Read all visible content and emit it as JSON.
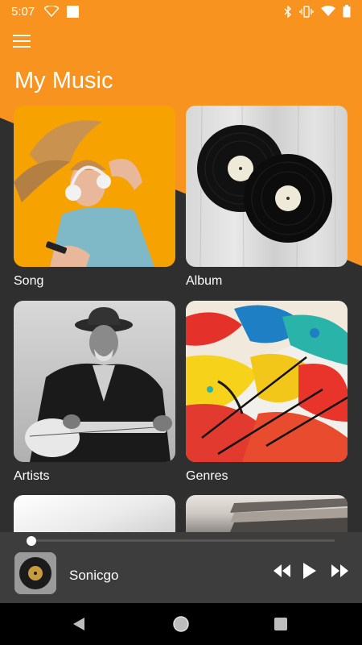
{
  "status_bar": {
    "time": "5:07"
  },
  "header": {
    "title": "My Music"
  },
  "tiles": [
    {
      "label": "Song"
    },
    {
      "label": "Album"
    },
    {
      "label": "Artists"
    },
    {
      "label": "Genres"
    },
    {
      "label": ""
    },
    {
      "label": ""
    }
  ],
  "player": {
    "track": "Sonicgo",
    "progress": 0.0
  },
  "colors": {
    "accent": "#f7931e",
    "background": "#2f2f2f",
    "player_bg": "#3d3d3d"
  },
  "icons": [
    "menu-icon",
    "wifi-icon",
    "bluetooth-icon",
    "vibrate-icon",
    "battery-icon",
    "rewind-icon",
    "play-icon",
    "fast-forward-icon",
    "back-icon",
    "home-icon",
    "recents-icon"
  ]
}
